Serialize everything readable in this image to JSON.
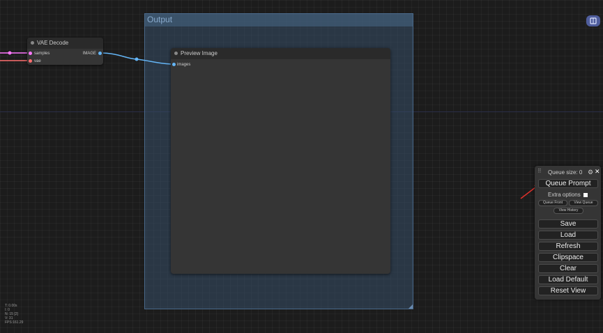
{
  "group": {
    "title": "Output"
  },
  "vae_decode": {
    "title": "VAE Decode",
    "inputs": [
      "samples",
      "vae"
    ],
    "output": "IMAGE"
  },
  "preview_image": {
    "title": "Preview Image",
    "input": "images"
  },
  "queue_panel": {
    "queue_size": "Queue size: 0",
    "queue_prompt": "Queue Prompt",
    "extra_options": "Extra options",
    "queue_front": "Queue Front",
    "view_queue": "View Queue",
    "view_history": "View History",
    "buttons": [
      "Save",
      "Load",
      "Refresh",
      "Clipspace",
      "Clear",
      "Load Default",
      "Reset View"
    ]
  },
  "stats": [
    "T: 0.00s",
    "I: 0",
    "N: 15 [2]",
    "V: 31",
    "FPS:161.29"
  ],
  "colors": {
    "samples_link": "#ff77ff",
    "vae_link": "#ff6e6e",
    "image_link": "#64b5f6",
    "group_border": "#4a6a8c",
    "arrow": "#e0302a"
  }
}
